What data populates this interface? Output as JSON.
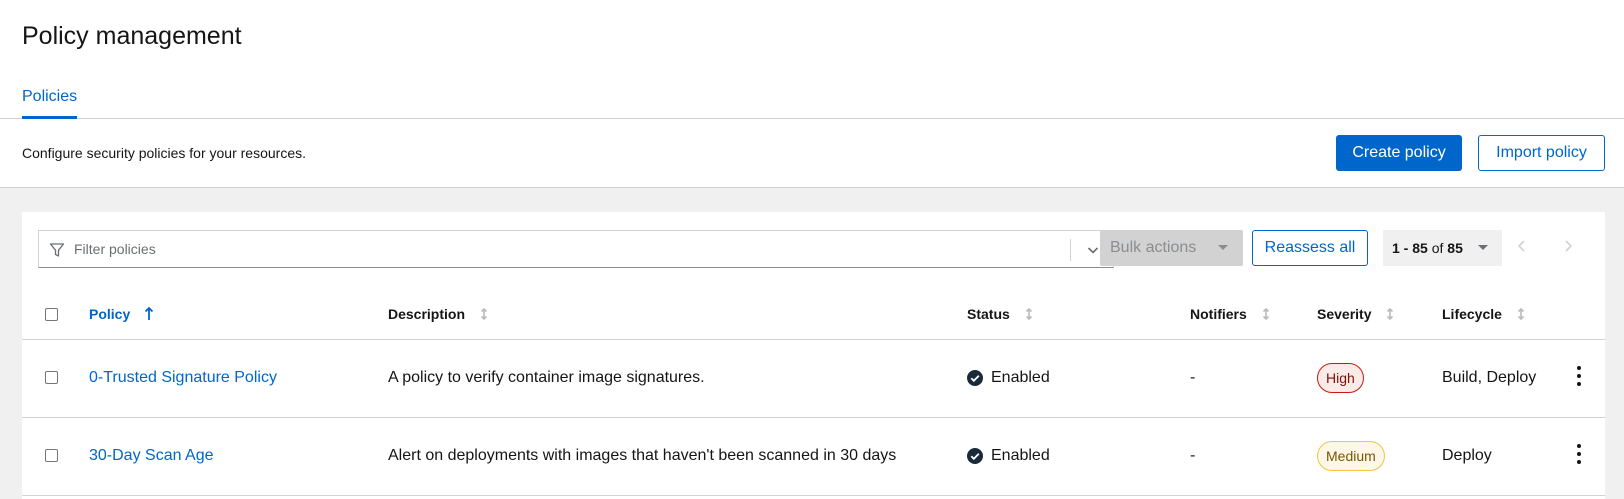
{
  "page": {
    "title": "Policy management",
    "tabs": [
      {
        "label": "Policies",
        "active": true
      }
    ],
    "description": "Configure security policies for your resources.",
    "create_button": "Create policy",
    "import_button": "Import policy"
  },
  "toolbar": {
    "filter_placeholder": "Filter policies",
    "bulk_actions": "Bulk actions",
    "reassess": "Reassess all",
    "pagination": {
      "range": "1 - 85",
      "of": "of",
      "total": "85"
    }
  },
  "table": {
    "columns": [
      "Policy",
      "Description",
      "Status",
      "Notifiers",
      "Severity",
      "Lifecycle"
    ],
    "rows": [
      {
        "policy": "0-Trusted Signature Policy",
        "description": "A policy to verify container image signatures.",
        "status": "Enabled",
        "notifiers": "-",
        "severity": "High",
        "lifecycle": "Build, Deploy"
      },
      {
        "policy": "30-Day Scan Age",
        "description": "Alert on deployments with images that haven't been scanned in 30 days",
        "status": "Enabled",
        "notifiers": "-",
        "severity": "Medium",
        "lifecycle": "Deploy"
      }
    ]
  },
  "colors": {
    "accent": "#0066cc",
    "high_badge": "#c9190b",
    "medium_badge": "#f4c145"
  },
  "icons": [
    "filter-icon",
    "chevron-down-icon",
    "caret-down-icon",
    "angle-left-icon",
    "angle-right-icon",
    "sort-ascending-icon",
    "sort-icon",
    "check-circle-icon",
    "kebab-icon"
  ]
}
